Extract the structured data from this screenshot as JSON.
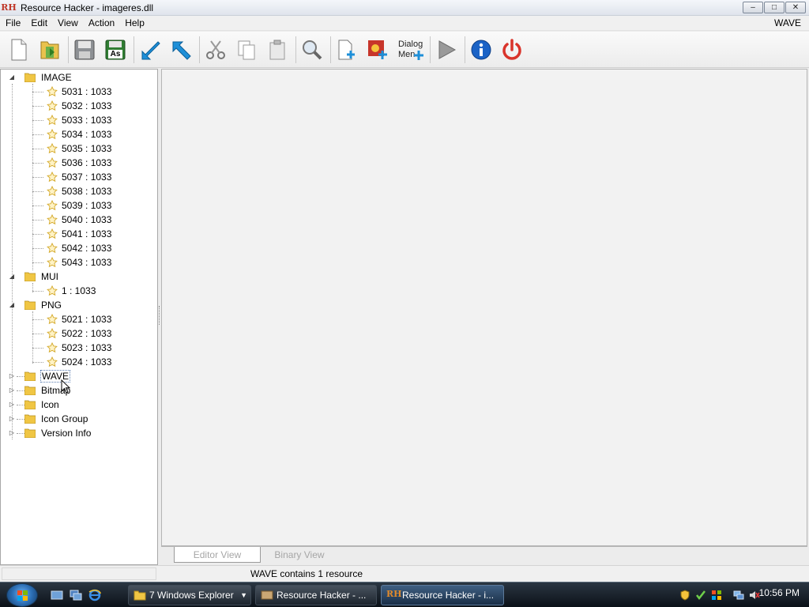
{
  "window": {
    "title": "Resource Hacker - imageres.dll",
    "logo_text": "RH"
  },
  "menu": {
    "items": [
      "File",
      "Edit",
      "View",
      "Action",
      "Help"
    ],
    "right_label": "WAVE"
  },
  "toolbar": {
    "buttons": [
      "new-file-icon",
      "open-folder-icon",
      "save-icon",
      "save-as-icon",
      "import-icon",
      "export-icon",
      "cut-icon",
      "copy-icon",
      "paste-icon",
      "search-icon",
      "add-resource-icon",
      "add-image-icon",
      "dialog-menu-icon",
      "run-icon",
      "info-icon",
      "power-icon"
    ],
    "save_as_label": "As",
    "dialog_label_1": "Dialog",
    "dialog_label_2": "Men"
  },
  "tree": {
    "image_group": "IMAGE",
    "image_items": [
      "5031 : 1033",
      "5032 : 1033",
      "5033 : 1033",
      "5034 : 1033",
      "5035 : 1033",
      "5036 : 1033",
      "5037 : 1033",
      "5038 : 1033",
      "5039 : 1033",
      "5040 : 1033",
      "5041 : 1033",
      "5042 : 1033",
      "5043 : 1033"
    ],
    "mui_group": "MUI",
    "mui_items": [
      "1 : 1033"
    ],
    "png_group": "PNG",
    "png_items": [
      "5021 : 1033",
      "5022 : 1033",
      "5023 : 1033",
      "5024 : 1033"
    ],
    "collapsed_groups": [
      "WAVE",
      "Bitmap",
      "Icon",
      "Icon Group",
      "Version Info"
    ],
    "selected": "WAVE"
  },
  "tabs": {
    "editor_view": "Editor View",
    "binary_view": "Binary View"
  },
  "status": {
    "text": "WAVE contains 1 resource"
  },
  "taskbar": {
    "buttons": [
      {
        "label": "7 Windows Explorer",
        "icon": "folder-icon"
      },
      {
        "label": "Resource Hacker - ...",
        "icon": "resource-hacker-icon"
      },
      {
        "label": "Resource Hacker - i...",
        "icon": "resource-hacker-icon"
      }
    ],
    "clock": "10:56 PM"
  },
  "colors": {
    "accent_folder": "#f0c644",
    "star": "#f2d36a",
    "close_red": "#d9342b",
    "info_blue": "#1b63c6"
  }
}
